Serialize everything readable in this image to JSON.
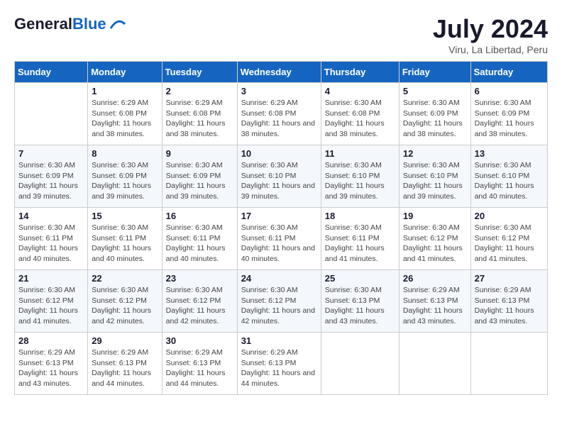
{
  "header": {
    "logo_general": "General",
    "logo_blue": "Blue",
    "month_title": "July 2024",
    "subtitle": "Viru, La Libertad, Peru"
  },
  "days_of_week": [
    "Sunday",
    "Monday",
    "Tuesday",
    "Wednesday",
    "Thursday",
    "Friday",
    "Saturday"
  ],
  "weeks": [
    [
      {
        "day": "",
        "sunrise": "",
        "sunset": "",
        "daylight": ""
      },
      {
        "day": "1",
        "sunrise": "Sunrise: 6:29 AM",
        "sunset": "Sunset: 6:08 PM",
        "daylight": "Daylight: 11 hours and 38 minutes."
      },
      {
        "day": "2",
        "sunrise": "Sunrise: 6:29 AM",
        "sunset": "Sunset: 6:08 PM",
        "daylight": "Daylight: 11 hours and 38 minutes."
      },
      {
        "day": "3",
        "sunrise": "Sunrise: 6:29 AM",
        "sunset": "Sunset: 6:08 PM",
        "daylight": "Daylight: 11 hours and 38 minutes."
      },
      {
        "day": "4",
        "sunrise": "Sunrise: 6:30 AM",
        "sunset": "Sunset: 6:08 PM",
        "daylight": "Daylight: 11 hours and 38 minutes."
      },
      {
        "day": "5",
        "sunrise": "Sunrise: 6:30 AM",
        "sunset": "Sunset: 6:09 PM",
        "daylight": "Daylight: 11 hours and 38 minutes."
      },
      {
        "day": "6",
        "sunrise": "Sunrise: 6:30 AM",
        "sunset": "Sunset: 6:09 PM",
        "daylight": "Daylight: 11 hours and 38 minutes."
      }
    ],
    [
      {
        "day": "7",
        "sunrise": "Sunrise: 6:30 AM",
        "sunset": "Sunset: 6:09 PM",
        "daylight": "Daylight: 11 hours and 39 minutes."
      },
      {
        "day": "8",
        "sunrise": "Sunrise: 6:30 AM",
        "sunset": "Sunset: 6:09 PM",
        "daylight": "Daylight: 11 hours and 39 minutes."
      },
      {
        "day": "9",
        "sunrise": "Sunrise: 6:30 AM",
        "sunset": "Sunset: 6:09 PM",
        "daylight": "Daylight: 11 hours and 39 minutes."
      },
      {
        "day": "10",
        "sunrise": "Sunrise: 6:30 AM",
        "sunset": "Sunset: 6:10 PM",
        "daylight": "Daylight: 11 hours and 39 minutes."
      },
      {
        "day": "11",
        "sunrise": "Sunrise: 6:30 AM",
        "sunset": "Sunset: 6:10 PM",
        "daylight": "Daylight: 11 hours and 39 minutes."
      },
      {
        "day": "12",
        "sunrise": "Sunrise: 6:30 AM",
        "sunset": "Sunset: 6:10 PM",
        "daylight": "Daylight: 11 hours and 39 minutes."
      },
      {
        "day": "13",
        "sunrise": "Sunrise: 6:30 AM",
        "sunset": "Sunset: 6:10 PM",
        "daylight": "Daylight: 11 hours and 40 minutes."
      }
    ],
    [
      {
        "day": "14",
        "sunrise": "Sunrise: 6:30 AM",
        "sunset": "Sunset: 6:11 PM",
        "daylight": "Daylight: 11 hours and 40 minutes."
      },
      {
        "day": "15",
        "sunrise": "Sunrise: 6:30 AM",
        "sunset": "Sunset: 6:11 PM",
        "daylight": "Daylight: 11 hours and 40 minutes."
      },
      {
        "day": "16",
        "sunrise": "Sunrise: 6:30 AM",
        "sunset": "Sunset: 6:11 PM",
        "daylight": "Daylight: 11 hours and 40 minutes."
      },
      {
        "day": "17",
        "sunrise": "Sunrise: 6:30 AM",
        "sunset": "Sunset: 6:11 PM",
        "daylight": "Daylight: 11 hours and 40 minutes."
      },
      {
        "day": "18",
        "sunrise": "Sunrise: 6:30 AM",
        "sunset": "Sunset: 6:11 PM",
        "daylight": "Daylight: 11 hours and 41 minutes."
      },
      {
        "day": "19",
        "sunrise": "Sunrise: 6:30 AM",
        "sunset": "Sunset: 6:12 PM",
        "daylight": "Daylight: 11 hours and 41 minutes."
      },
      {
        "day": "20",
        "sunrise": "Sunrise: 6:30 AM",
        "sunset": "Sunset: 6:12 PM",
        "daylight": "Daylight: 11 hours and 41 minutes."
      }
    ],
    [
      {
        "day": "21",
        "sunrise": "Sunrise: 6:30 AM",
        "sunset": "Sunset: 6:12 PM",
        "daylight": "Daylight: 11 hours and 41 minutes."
      },
      {
        "day": "22",
        "sunrise": "Sunrise: 6:30 AM",
        "sunset": "Sunset: 6:12 PM",
        "daylight": "Daylight: 11 hours and 42 minutes."
      },
      {
        "day": "23",
        "sunrise": "Sunrise: 6:30 AM",
        "sunset": "Sunset: 6:12 PM",
        "daylight": "Daylight: 11 hours and 42 minutes."
      },
      {
        "day": "24",
        "sunrise": "Sunrise: 6:30 AM",
        "sunset": "Sunset: 6:12 PM",
        "daylight": "Daylight: 11 hours and 42 minutes."
      },
      {
        "day": "25",
        "sunrise": "Sunrise: 6:30 AM",
        "sunset": "Sunset: 6:13 PM",
        "daylight": "Daylight: 11 hours and 43 minutes."
      },
      {
        "day": "26",
        "sunrise": "Sunrise: 6:29 AM",
        "sunset": "Sunset: 6:13 PM",
        "daylight": "Daylight: 11 hours and 43 minutes."
      },
      {
        "day": "27",
        "sunrise": "Sunrise: 6:29 AM",
        "sunset": "Sunset: 6:13 PM",
        "daylight": "Daylight: 11 hours and 43 minutes."
      }
    ],
    [
      {
        "day": "28",
        "sunrise": "Sunrise: 6:29 AM",
        "sunset": "Sunset: 6:13 PM",
        "daylight": "Daylight: 11 hours and 43 minutes."
      },
      {
        "day": "29",
        "sunrise": "Sunrise: 6:29 AM",
        "sunset": "Sunset: 6:13 PM",
        "daylight": "Daylight: 11 hours and 44 minutes."
      },
      {
        "day": "30",
        "sunrise": "Sunrise: 6:29 AM",
        "sunset": "Sunset: 6:13 PM",
        "daylight": "Daylight: 11 hours and 44 minutes."
      },
      {
        "day": "31",
        "sunrise": "Sunrise: 6:29 AM",
        "sunset": "Sunset: 6:13 PM",
        "daylight": "Daylight: 11 hours and 44 minutes."
      },
      {
        "day": "",
        "sunrise": "",
        "sunset": "",
        "daylight": ""
      },
      {
        "day": "",
        "sunrise": "",
        "sunset": "",
        "daylight": ""
      },
      {
        "day": "",
        "sunrise": "",
        "sunset": "",
        "daylight": ""
      }
    ]
  ]
}
